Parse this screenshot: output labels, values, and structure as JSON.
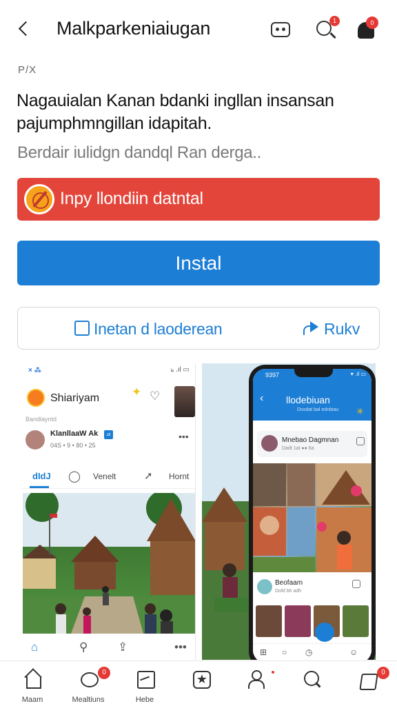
{
  "header": {
    "title": "Malkparkeniaiugan",
    "search_badge": "1",
    "bell_badge": "0"
  },
  "tag": "P/X",
  "headline": "Nagauialan Kanan bdanki ingllan insansan pajumphmngillan idapitah.",
  "subtitle": "Berdair iulidgn dandql Ran derga..",
  "red_button": {
    "label": "Inpy llondiin datntal"
  },
  "install_button": {
    "label": "Instal"
  },
  "outline_button": {
    "left_label": "Inetan d laoderean",
    "right_label": "Rukv"
  },
  "left_screen": {
    "status_left": "×  ⁂",
    "status_right": "᥀ .ıl ▭",
    "name": "Shiariyam",
    "section": "Bandlayntd",
    "post_name": "KlanllaaW Ak",
    "post_badge": "ㄹ",
    "post_meta": "04S • 9\n• 80 • 25",
    "tab_active": "dIdJ",
    "tab2": "Venelt",
    "tab3": "Hornt"
  },
  "right_screen": {
    "time": "9397",
    "signals": "▾ .ıl ▭",
    "title": "llodebiuan",
    "subtitle": "Dosdat bal ednbiau",
    "card_name": "Mnebao Dagmnan",
    "card_meta": "Dadt 1at ●● 6a",
    "card2_name": "Beofaam",
    "card2_meta": "Dofd bh adh"
  },
  "bottom_nav": {
    "items": [
      {
        "label": "Maam",
        "icon": "home-icon",
        "badge": ""
      },
      {
        "label": "Mealtiuns",
        "icon": "message-icon",
        "badge": "0"
      },
      {
        "label": "Hebe",
        "icon": "image-icon",
        "badge": ""
      },
      {
        "label": "",
        "icon": "favorite-icon",
        "badge": ""
      },
      {
        "label": "",
        "icon": "person-icon",
        "badge": ""
      },
      {
        "label": "",
        "icon": "search-icon",
        "badge": ""
      },
      {
        "label": "",
        "icon": "bag-icon",
        "badge": "0"
      }
    ]
  },
  "colors": {
    "accent_blue": "#1d7ed6",
    "accent_red": "#e4453a",
    "badge_red": "#e53935"
  }
}
